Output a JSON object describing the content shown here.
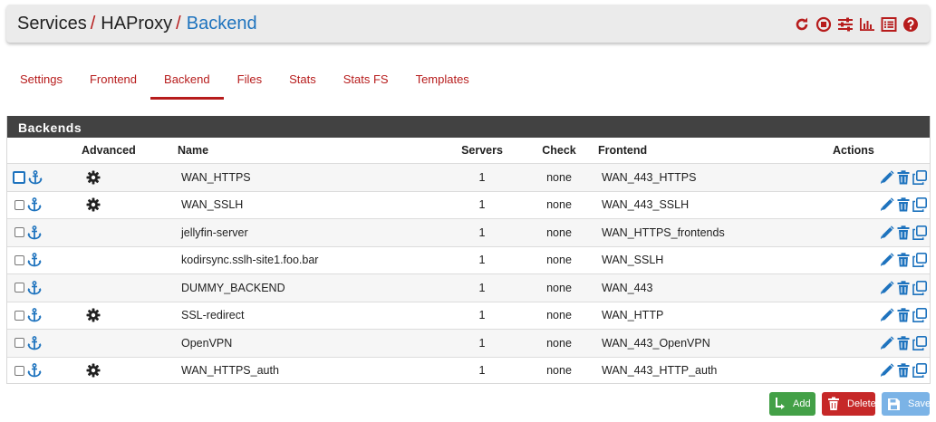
{
  "breadcrumb": {
    "part1": "Services",
    "sep1": "/",
    "part2": "HAProxy",
    "sep2": "/",
    "current": "Backend"
  },
  "header_icons": [
    "reload-icon",
    "stop-icon",
    "sliders-icon",
    "bar-chart-icon",
    "list-icon",
    "help-icon"
  ],
  "tabs": [
    {
      "label": "Settings",
      "active": false
    },
    {
      "label": "Frontend",
      "active": false
    },
    {
      "label": "Backend",
      "active": true
    },
    {
      "label": "Files",
      "active": false
    },
    {
      "label": "Stats",
      "active": false
    },
    {
      "label": "Stats FS",
      "active": false
    },
    {
      "label": "Templates",
      "active": false
    }
  ],
  "panel": {
    "title": "Backends",
    "columns": {
      "advanced": "Advanced",
      "name": "Name",
      "servers": "Servers",
      "check": "Check",
      "frontend": "Frontend",
      "actions": "Actions"
    },
    "rows": [
      {
        "advanced": true,
        "name": "WAN_HTTPS",
        "servers": "1",
        "check": "none",
        "frontend": "WAN_443_HTTPS"
      },
      {
        "advanced": true,
        "name": "WAN_SSLH",
        "servers": "1",
        "check": "none",
        "frontend": "WAN_443_SSLH"
      },
      {
        "advanced": false,
        "name": "jellyfin-server",
        "servers": "1",
        "check": "none",
        "frontend": "WAN_HTTPS_frontends"
      },
      {
        "advanced": false,
        "name": "kodirsync.sslh-site1.foo.bar",
        "servers": "1",
        "check": "none",
        "frontend": "WAN_SSLH"
      },
      {
        "advanced": false,
        "name": "DUMMY_BACKEND",
        "servers": "1",
        "check": "none",
        "frontend": "WAN_443"
      },
      {
        "advanced": true,
        "name": "SSL-redirect",
        "servers": "1",
        "check": "none",
        "frontend": "WAN_HTTP"
      },
      {
        "advanced": false,
        "name": "OpenVPN",
        "servers": "1",
        "check": "none",
        "frontend": "WAN_443_OpenVPN"
      },
      {
        "advanced": true,
        "name": "WAN_HTTPS_auth",
        "servers": "1",
        "check": "none",
        "frontend": "WAN_443_HTTP_auth"
      }
    ]
  },
  "buttons": {
    "add": "Add",
    "delete": "Delete",
    "save": "Save"
  },
  "colors": {
    "accent_red": "#b71c1c",
    "link_blue": "#1e73be",
    "panel_head": "#424242",
    "add_green": "#43a047",
    "delete_red": "#c62828",
    "save_blue": "#7bb3e6"
  }
}
